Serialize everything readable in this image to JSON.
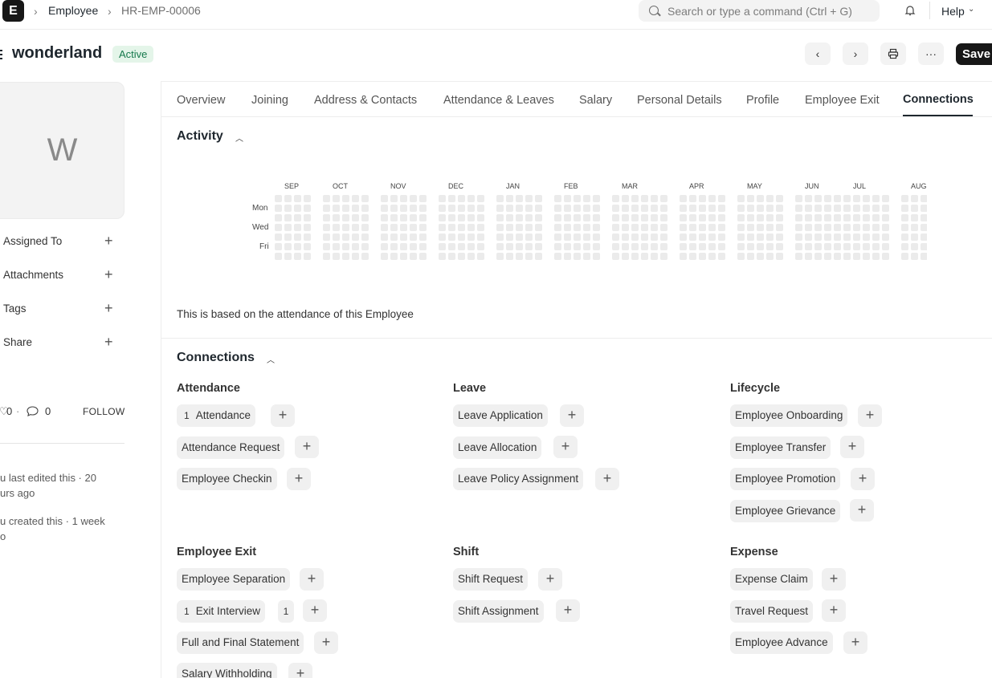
{
  "navbar": {
    "logo": "E",
    "breadcrumbs": [
      "Employee",
      "HR-EMP-00006"
    ],
    "search_placeholder": "Search or type a command (Ctrl + G)",
    "help_label": "Help"
  },
  "header": {
    "title": "wonderland",
    "status": "Active",
    "save_label": "Save"
  },
  "sidebar": {
    "avatar_letter": "W",
    "items": [
      "Assigned To",
      "Attachments",
      "Tags",
      "Share"
    ],
    "likes": "0",
    "comments": "0",
    "follow_label": "FOLLOW",
    "notes": [
      "u last edited this · 20",
      "urs ago",
      "u created this · 1 week",
      "o"
    ]
  },
  "tabs": [
    "Overview",
    "Joining",
    "Address & Contacts",
    "Attendance & Leaves",
    "Salary",
    "Personal Details",
    "Profile",
    "Employee Exit",
    "Connections"
  ],
  "activity": {
    "title": "Activity",
    "months": [
      "SEP",
      "OCT",
      "NOV",
      "DEC",
      "JAN",
      "FEB",
      "MAR",
      "APR",
      "MAY",
      "JUN",
      "JUL",
      "AUG"
    ],
    "days": [
      "Mon",
      "Wed",
      "Fri"
    ],
    "note": "This is based on the attendance of this Employee"
  },
  "connections": {
    "title": "Connections",
    "groups": {
      "attendance": {
        "title": "Attendance",
        "items": [
          "Attendance",
          "Attendance Request",
          "Employee Checkin"
        ],
        "count_attendance": "1"
      },
      "leave": {
        "title": "Leave",
        "items": [
          "Leave Application",
          "Leave Allocation",
          "Leave Policy Assignment"
        ]
      },
      "lifecycle": {
        "title": "Lifecycle",
        "items": [
          "Employee Onboarding",
          "Employee Transfer",
          "Employee Promotion",
          "Employee Grievance"
        ]
      },
      "exit": {
        "title": "Employee Exit",
        "items": [
          "Employee Separation",
          "Exit Interview",
          "Full and Final Statement",
          "Salary Withholding"
        ],
        "count_exit_interview": "1",
        "badge_exit_interview": "1"
      },
      "shift": {
        "title": "Shift",
        "items": [
          "Shift Request",
          "Shift Assignment"
        ]
      },
      "expense": {
        "title": "Expense",
        "items": [
          "Expense Claim",
          "Travel Request",
          "Employee Advance"
        ]
      }
    }
  }
}
